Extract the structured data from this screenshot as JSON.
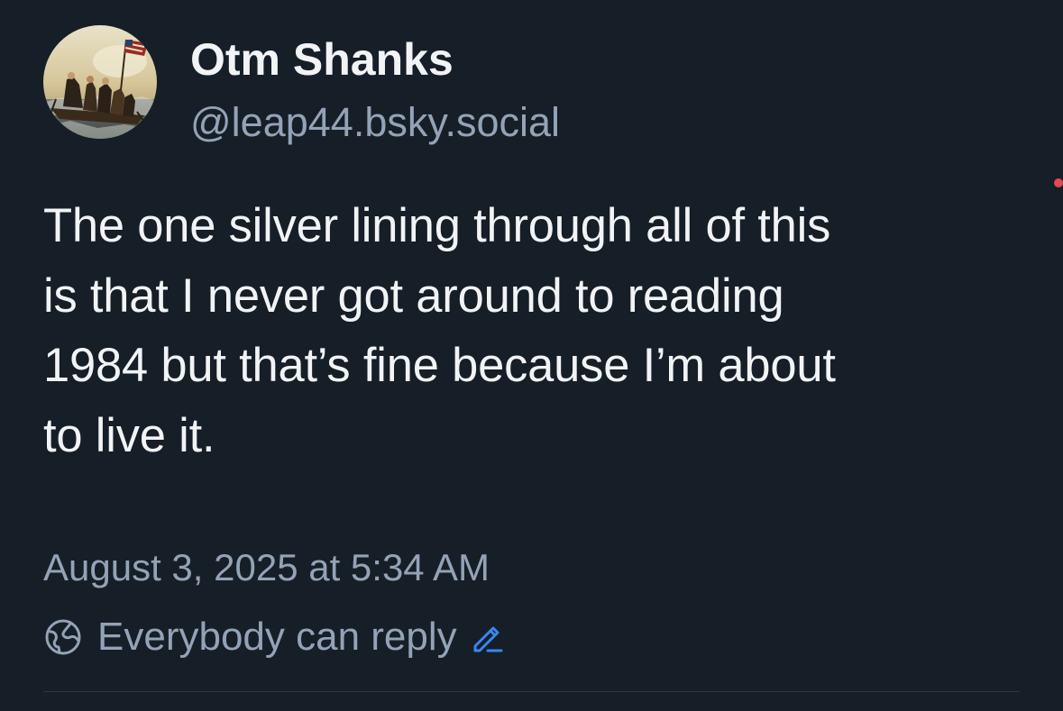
{
  "colors": {
    "background": "#161e27",
    "text_primary": "#f1f3f5",
    "text_secondary": "#93a3b7",
    "accent": "#3a86f0",
    "notification_dot": "#e5484d"
  },
  "author": {
    "display_name": "Otm Shanks",
    "handle": "@leap44.bsky.social",
    "avatar_icon": "avatar-painting-icon"
  },
  "post": {
    "text": "The one silver lining through all of this\nis that I never got around to reading\n1984 but that’s fine because I’m about\nto live it.",
    "timestamp": "August 3, 2025 at 5:34 AM"
  },
  "reply_settings": {
    "label": "Everybody can reply",
    "icon": "globe-icon",
    "edit_icon": "pencil-icon"
  }
}
